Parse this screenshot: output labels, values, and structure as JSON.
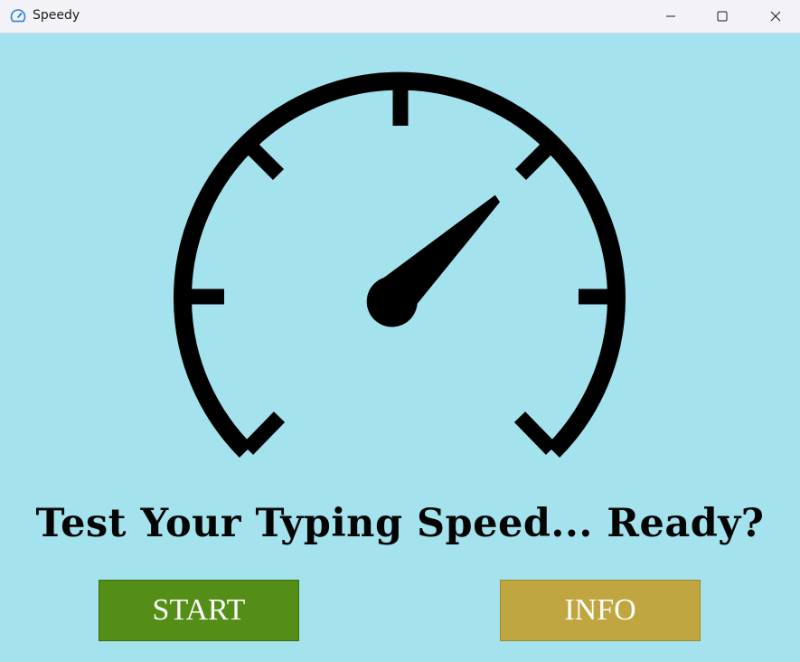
{
  "window": {
    "title": "Speedy",
    "app_icon": "speedometer-icon",
    "controls": {
      "minimize": "minimize-icon",
      "maximize": "maximize-icon",
      "close": "close-icon"
    }
  },
  "main": {
    "illustration": "speedometer-icon",
    "headline": "Test Your Typing Speed... Ready?",
    "start_label": "START",
    "info_label": "INFO"
  },
  "colors": {
    "background": "#a4e3ee",
    "start_button": "#558e16",
    "info_button": "#bfa640",
    "headline_text": "#050505",
    "button_text": "#ffffff"
  }
}
